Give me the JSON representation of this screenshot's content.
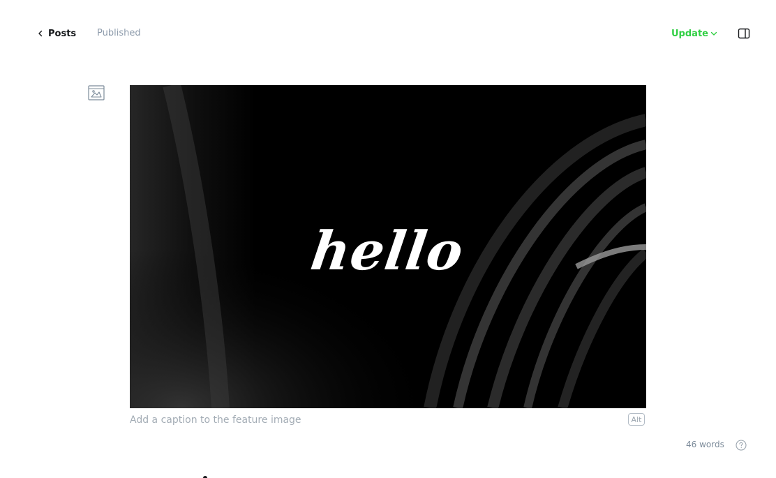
{
  "header": {
    "back_label": "Posts",
    "status": "Published",
    "update_label": "Update"
  },
  "icons": {
    "back": "chevron-left-icon",
    "update_dropdown": "chevron-down-icon",
    "sidebar_toggle": "sidebar-panel-icon",
    "feature_image": "image-icon",
    "help": "question-circle-icon"
  },
  "feature_image": {
    "text": "hello",
    "caption_placeholder": "Add a caption to the feature image",
    "alt_label": "Alt"
  },
  "footer": {
    "word_count": "46 words"
  },
  "colors": {
    "accent_green": "#30cf43",
    "muted_text": "#8e9cac",
    "image_background": "#000000"
  }
}
